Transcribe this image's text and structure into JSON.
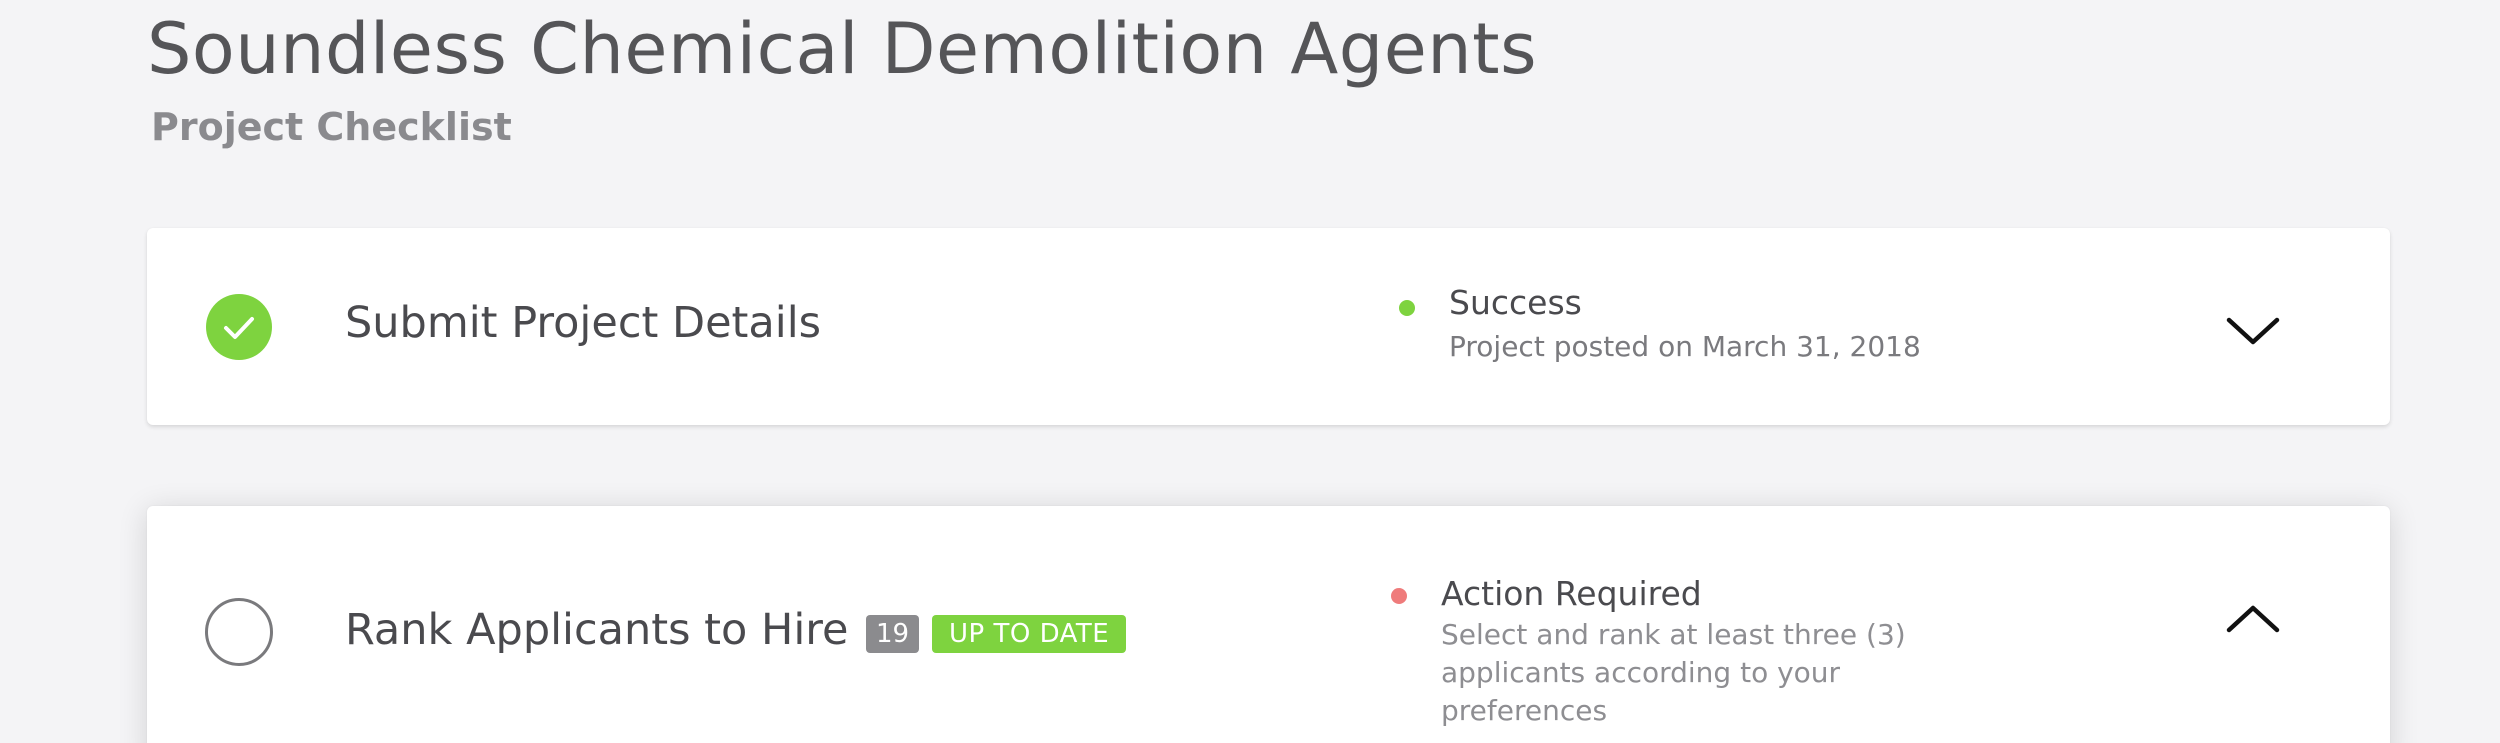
{
  "header": {
    "title": "Soundless Chemical Demolition Agents",
    "subtitle": "Project Checklist"
  },
  "steps": [
    {
      "title": "Submit Project Details",
      "completed": true,
      "status": {
        "label": "Success",
        "detail": "Project posted on March 31, 2018",
        "color": "#7ed33f"
      },
      "expanded": false,
      "toggle_icon": "chevron-down-icon"
    },
    {
      "title": "Rank Applicants to Hire",
      "completed": false,
      "count_badge": "19",
      "state_badge": "UP TO DATE",
      "status": {
        "label": "Action Required",
        "detail": "Select and rank at least three (3) applicants according to your preferences",
        "color": "#ef7b7b"
      },
      "expanded": true,
      "toggle_icon": "chevron-up-icon"
    }
  ],
  "colors": {
    "success": "#7ed33f",
    "action_required": "#ef7b7b",
    "badge_gray": "#8b8b8e",
    "background": "#f4f4f6"
  }
}
